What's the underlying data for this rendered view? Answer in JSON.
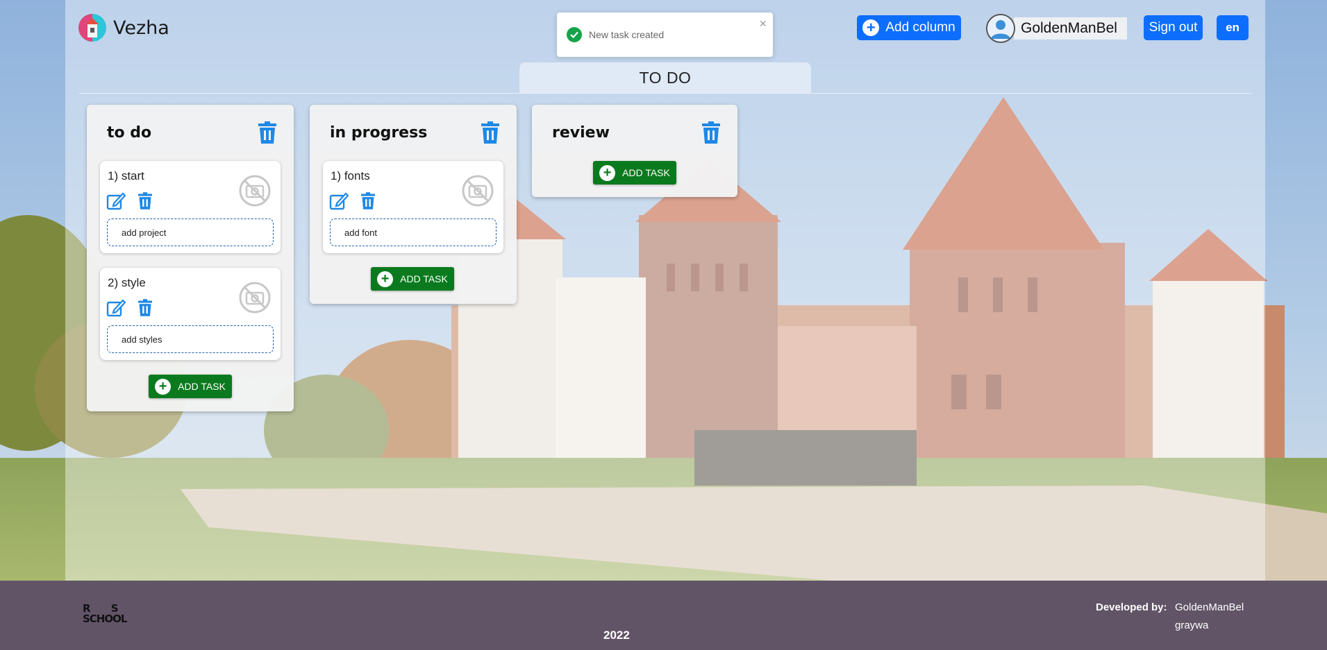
{
  "app": {
    "name": "Vezha"
  },
  "toast": {
    "message": "New task created",
    "close_glyph": "×",
    "status_color": "#16a34a"
  },
  "header": {
    "add_column_label": "Add column",
    "username": "GoldenManBel",
    "sign_out_label": "Sign out",
    "language_label": "en",
    "accent_color": "#0d6efd"
  },
  "board": {
    "title": "TO DO"
  },
  "columns": [
    {
      "title": "to do",
      "tasks": [
        {
          "title": "1) start",
          "description": "add project"
        },
        {
          "title": "2) style",
          "description": "add styles"
        }
      ],
      "add_task_label": "ADD TASK"
    },
    {
      "title": "in progress",
      "tasks": [
        {
          "title": "1) fonts",
          "description": "add font"
        }
      ],
      "add_task_label": "ADD TASK"
    },
    {
      "title": "review",
      "tasks": [],
      "add_task_label": "ADD TASK"
    }
  ],
  "icons": {
    "column_delete": "trash-icon",
    "task_edit": "edit-icon",
    "task_delete": "trash-icon",
    "task_image": "no-image-icon",
    "add": "plus-circle-icon",
    "toast_status": "check-circle-icon"
  },
  "footer": {
    "logo_text_top": "R S",
    "logo_text_bottom": "SCHOOL",
    "year": "2022",
    "developed_by_label": "Developed by:",
    "developers": [
      "GoldenManBel",
      "graywa"
    ]
  },
  "colors": {
    "add_task_green": "#0b7a1e",
    "footer_bg": "#625467",
    "trash_blue": "#1e88e5"
  }
}
